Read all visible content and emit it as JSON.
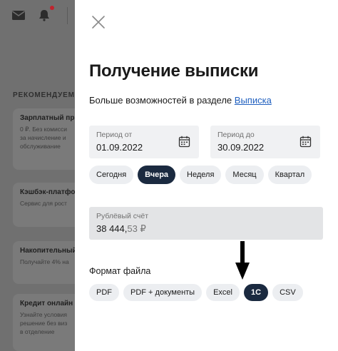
{
  "background": {
    "recommend_heading": "РЕКОМЕНДУЕМ",
    "cards": [
      {
        "title": "Зарплатный про",
        "lines": [
          "0 ₽. Без комисси",
          "за начисление и",
          "обслуживание"
        ]
      },
      {
        "title": "Кэшбэк-платфо",
        "lines": [
          "Сервис для рост"
        ]
      },
      {
        "title": "Накопительный",
        "lines": [
          "Получайте 4% на"
        ]
      },
      {
        "title": "Кредит онлайн",
        "lines": [
          "Узнайте условия",
          "решение без виз",
          "в отделение"
        ]
      }
    ],
    "icons": [
      "mail-icon",
      "bell-icon"
    ],
    "notification_dot_color": "#c0242e"
  },
  "modal": {
    "close_icon": "close-icon",
    "title": "Получение выписки",
    "subtitle_text": "Больше возможностей в разделе ",
    "subtitle_link": "Выписка",
    "date_from": {
      "label": "Период от",
      "value": "01.09.2022",
      "icon": "calendar-icon"
    },
    "date_to": {
      "label": "Период до",
      "value": "30.09.2022",
      "icon": "calendar-icon"
    },
    "period_chips": [
      {
        "label": "Сегодня",
        "selected": false
      },
      {
        "label": "Вчера",
        "selected": true
      },
      {
        "label": "Неделя",
        "selected": false
      },
      {
        "label": "Месяц",
        "selected": false
      },
      {
        "label": "Квартал",
        "selected": false
      }
    ],
    "account": {
      "label": "Рублёвый счёт",
      "amount_main": "38 444,",
      "amount_cents": "53 ₽"
    },
    "format_label": "Формат файла",
    "format_chips": [
      {
        "label": "PDF",
        "selected": false
      },
      {
        "label": "PDF + документы",
        "selected": false
      },
      {
        "label": "Excel",
        "selected": false
      },
      {
        "label": "1С",
        "selected": true
      },
      {
        "label": "CSV",
        "selected": false
      }
    ],
    "annotation_arrow": "arrow-down-icon"
  },
  "colors": {
    "accent_dark": "#1b2a40",
    "link": "#1f5fbf",
    "overlay": "#707070"
  }
}
